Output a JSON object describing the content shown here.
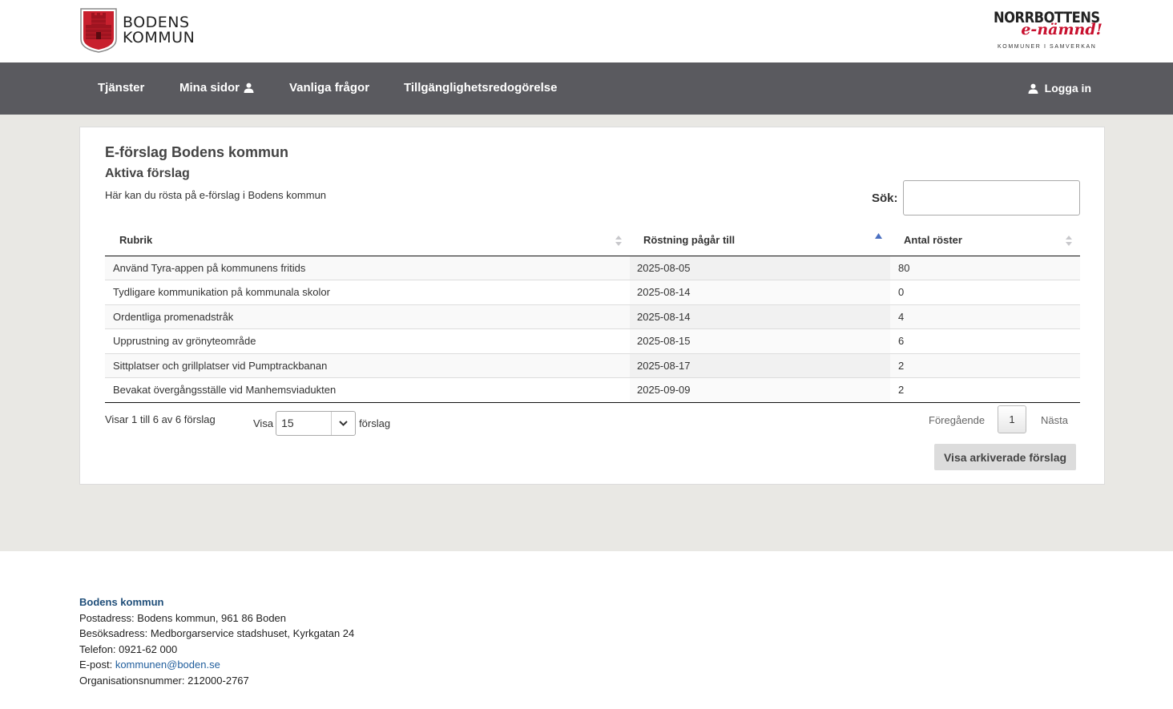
{
  "header": {
    "logo_left_line1": "BODENS",
    "logo_left_line2": "KOMMUN",
    "logo_right_title": "NORRBOTTENS",
    "logo_right_script": "e-nämnd!",
    "logo_right_sub": "KOMMUNER I SAMVERKAN"
  },
  "nav": {
    "items": [
      {
        "label": "Tjänster"
      },
      {
        "label": "Mina sidor"
      },
      {
        "label": "Vanliga frågor"
      },
      {
        "label": "Tillgänglighetsredogörelse"
      }
    ],
    "login_label": "Logga in"
  },
  "page": {
    "title": "E-förslag Bodens kommun",
    "subtitle": "Aktiva förslag",
    "description": "Här kan du rösta på e-förslag i Bodens kommun",
    "search_label": "Sök:",
    "search_value": ""
  },
  "table": {
    "columns": [
      "Rubrik",
      "Röstning pågår till",
      "Antal röster"
    ],
    "rows": [
      {
        "rubrik": "Använd Tyra-appen på kommunens fritids",
        "datum": "2025-08-05",
        "antal": "80"
      },
      {
        "rubrik": "Tydligare kommunikation på kommunala skolor",
        "datum": "2025-08-14",
        "antal": "0"
      },
      {
        "rubrik": "Ordentliga promenadstråk",
        "datum": "2025-08-14",
        "antal": "4"
      },
      {
        "rubrik": "Upprustning av grönyteområde",
        "datum": "2025-08-15",
        "antal": "6"
      },
      {
        "rubrik": "Sittplatser och grillplatser vid Pumptrackbanan",
        "datum": "2025-08-17",
        "antal": "2"
      },
      {
        "rubrik": "Bevakat övergångsställe vid Manhemsviadukten",
        "datum": "2025-09-09",
        "antal": "2"
      }
    ],
    "info": "Visar 1 till 6 av 6 förslag",
    "length_prefix": "Visa",
    "length_value": "15",
    "length_suffix": "förslag",
    "prev_label": "Föregående",
    "current_page": "1",
    "next_label": "Nästa",
    "archive_button": "Visa arkiverade förslag"
  },
  "footer": {
    "name": "Bodens kommun",
    "postal_prefix": "Postadress:",
    "postal": "Bodens kommun, 961 86 Boden",
    "visit_prefix": "Besöksadress:",
    "visit": "Medborgarservice stadshuset, Kyrkgatan 24",
    "phone_prefix": "Telefon:",
    "phone": "0921-62 000",
    "email_prefix": "E-post:",
    "email": "kommunen@boden.se",
    "org_prefix": "Organisationsnummer:",
    "org": "212000-2767"
  },
  "colors": {
    "nav_bg": "#5a5a5f",
    "page_bg": "#e9e8e4",
    "crest_red": "#c8202e",
    "accent_red": "#c8102e",
    "sort_active": "#4a6fc1",
    "footer_link": "#1f5d9c"
  },
  "icons": {
    "user": "user-icon",
    "sort": "sort-both-icon",
    "sort_asc": "sort-asc-icon",
    "chevron": "chevron-down-icon",
    "crest": "bodens-crest-icon"
  }
}
